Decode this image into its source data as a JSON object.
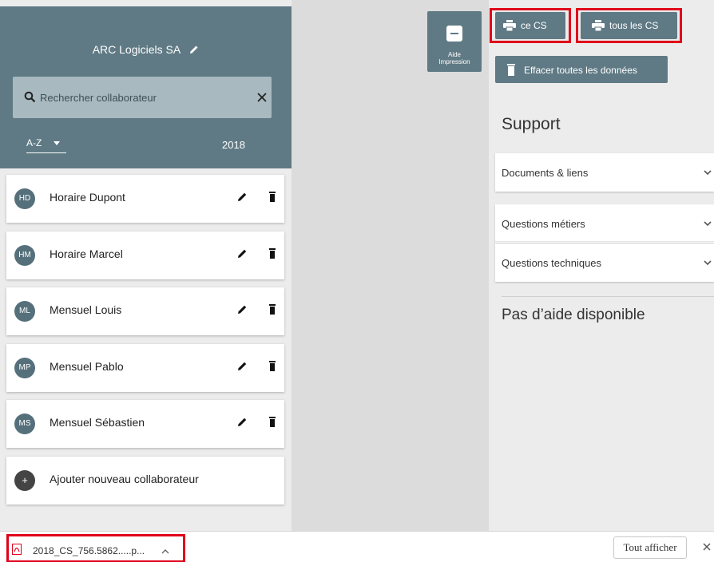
{
  "left_panel": {
    "company": "ARC Logiciels SA",
    "search": {
      "placeholder": "Rechercher collaborateur",
      "value": ""
    },
    "sort": "A-Z",
    "year": "2018",
    "employees": [
      {
        "initials": "HD",
        "name": "Horaire Dupont"
      },
      {
        "initials": "HM",
        "name": "Horaire Marcel"
      },
      {
        "initials": "ML",
        "name": "Mensuel Louis"
      },
      {
        "initials": "MP",
        "name": "Mensuel Pablo"
      },
      {
        "initials": "MS",
        "name": "Mensuel Sébastien"
      }
    ],
    "add": {
      "symbol": "+",
      "label": "Ajouter nouveau collaborateur"
    }
  },
  "aide_button": {
    "line1": "Aide",
    "line2": "Impression"
  },
  "right_panel": {
    "print_this": "ce CS",
    "print_all": "tous les CS",
    "clear_data": "Effacer toutes les données",
    "support_title": "Support",
    "accordion": [
      "Documents & liens",
      "Questions métiers",
      "Questions techniques"
    ],
    "no_help": "Pas d’aide disponible"
  },
  "download_bar": {
    "filename": "2018_CS_756.5862.....p...",
    "show_all": "Tout afficher"
  },
  "colors": {
    "header": "#5f7a85",
    "highlight": "#e0001b",
    "avatar": "#55707b"
  },
  "icons": [
    "pencil-icon",
    "search-icon",
    "close-icon",
    "caret-down-icon",
    "trash-icon",
    "printer-icon",
    "chevron-down-icon",
    "pdf-icon",
    "chevron-up-icon"
  ]
}
